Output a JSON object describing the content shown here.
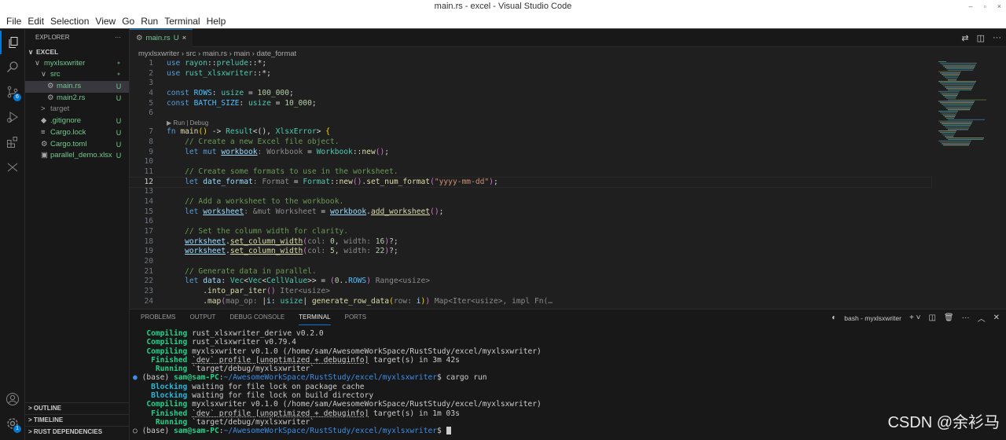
{
  "window": {
    "title": "main.rs - excel - Visual Studio Code",
    "controls": [
      "–",
      "▫",
      "×"
    ]
  },
  "menu": [
    "File",
    "Edit",
    "Selection",
    "View",
    "Go",
    "Run",
    "Terminal",
    "Help"
  ],
  "activity": {
    "scm_badge": "6",
    "settings_badge": "1"
  },
  "sidebar": {
    "title": "EXPLORER",
    "more": "···",
    "root": "EXCEL",
    "items": [
      {
        "label": "myxlsxwriter",
        "indent": 1,
        "twisty": "∨",
        "status": "●",
        "color": "green"
      },
      {
        "label": "src",
        "indent": 2,
        "twisty": "∨",
        "status": "●",
        "color": "green"
      },
      {
        "label": "main.rs",
        "indent": 3,
        "icon": "⚙",
        "status": "U",
        "color": "green",
        "selected": true
      },
      {
        "label": "main2.rs",
        "indent": 3,
        "icon": "⚙",
        "status": "U",
        "color": "green"
      },
      {
        "label": "target",
        "indent": 2,
        "twisty": ">",
        "status": "",
        "color": "grey"
      },
      {
        "label": ".gitignore",
        "indent": 2,
        "icon": "◆",
        "status": "U",
        "color": "green"
      },
      {
        "label": "Cargo.lock",
        "indent": 2,
        "icon": "≡",
        "status": "U",
        "color": "green"
      },
      {
        "label": "Cargo.toml",
        "indent": 2,
        "icon": "⚙",
        "status": "U",
        "color": "green"
      },
      {
        "label": "parallel_demo.xlsx",
        "indent": 2,
        "icon": "▣",
        "status": "U",
        "color": "green"
      }
    ],
    "sections": [
      "OUTLINE",
      "TIMELINE",
      "RUST DEPENDENCIES"
    ]
  },
  "editor": {
    "tab": {
      "label": "main.rs",
      "status": "U",
      "close": "×"
    },
    "breadcrumb": [
      "myxlsxwriter",
      "src",
      "main.rs",
      "main",
      "date_format"
    ],
    "codelens": "▶ Run | Debug",
    "current_line": 12,
    "lines": [
      [
        [
          "use ",
          "kw"
        ],
        [
          "rayon",
          "ty"
        ],
        [
          "::",
          "pu"
        ],
        [
          "prelude",
          "ty"
        ],
        [
          "::*;",
          "pu"
        ]
      ],
      [
        [
          "use ",
          "kw"
        ],
        [
          "rust_xlsxwriter",
          "ty"
        ],
        [
          "::*;",
          "pu"
        ]
      ],
      [],
      [
        [
          "const ",
          "kw"
        ],
        [
          "ROWS",
          "co"
        ],
        [
          ": ",
          "pu"
        ],
        [
          "usize",
          "ty"
        ],
        [
          " = ",
          "pu"
        ],
        [
          "100_000",
          "nu"
        ],
        [
          ";",
          "pu"
        ]
      ],
      [
        [
          "const ",
          "kw"
        ],
        [
          "BATCH_SIZE",
          "co"
        ],
        [
          ": ",
          "pu"
        ],
        [
          "usize",
          "ty"
        ],
        [
          " = ",
          "pu"
        ],
        [
          "10_000",
          "nu"
        ],
        [
          ";",
          "pu"
        ]
      ],
      [],
      [
        [
          "fn ",
          "kw"
        ],
        [
          "main",
          "fn"
        ],
        [
          "()",
          "br"
        ],
        [
          " -> ",
          "pu"
        ],
        [
          "Result",
          "ty"
        ],
        [
          "<(), ",
          "pu"
        ],
        [
          "XlsxError",
          "ty"
        ],
        [
          "> ",
          "pu"
        ],
        [
          "{",
          "br"
        ]
      ],
      [
        [
          "    // Create a new Excel file object.",
          "cm"
        ]
      ],
      [
        [
          "    let mut ",
          "kw"
        ],
        [
          "workbook",
          "va ul"
        ],
        [
          ": Workbook",
          "hi"
        ],
        [
          " = ",
          "pu"
        ],
        [
          "Workbook",
          "ty"
        ],
        [
          "::",
          "pu"
        ],
        [
          "new",
          "fn"
        ],
        [
          "()",
          "br2"
        ],
        [
          ";",
          "pu"
        ]
      ],
      [],
      [
        [
          "    // Create some formats to use in the worksheet.",
          "cm"
        ]
      ],
      [
        [
          "    let ",
          "kw"
        ],
        [
          "date_format",
          "va"
        ],
        [
          ": Format",
          "hi"
        ],
        [
          " = ",
          "pu"
        ],
        [
          "Format",
          "ty"
        ],
        [
          "::",
          "pu"
        ],
        [
          "new",
          "fn"
        ],
        [
          "()",
          "br2"
        ],
        [
          ".",
          "pu"
        ],
        [
          "set_num_format",
          "fn"
        ],
        [
          "(",
          "br2"
        ],
        [
          "\"yyyy-mm-dd\"",
          "st"
        ],
        [
          ")",
          "br2"
        ],
        [
          ";",
          "pu"
        ]
      ],
      [],
      [
        [
          "    // Add a worksheet to the workbook.",
          "cm"
        ]
      ],
      [
        [
          "    let ",
          "kw"
        ],
        [
          "worksheet",
          "va ul"
        ],
        [
          ": &mut Worksheet",
          "hi"
        ],
        [
          " = ",
          "pu"
        ],
        [
          "workbook",
          "va ul"
        ],
        [
          ".",
          "pu"
        ],
        [
          "add_worksheet",
          "fn ul"
        ],
        [
          "()",
          "br2"
        ],
        [
          ";",
          "pu"
        ]
      ],
      [],
      [
        [
          "    // Set the column width for clarity.",
          "cm"
        ]
      ],
      [
        [
          "    ",
          "pu"
        ],
        [
          "worksheet",
          "va ul"
        ],
        [
          ".",
          "pu"
        ],
        [
          "set_column_width",
          "fn ul"
        ],
        [
          "(",
          "br2"
        ],
        [
          "col: ",
          "hi"
        ],
        [
          "0",
          "nu"
        ],
        [
          ", ",
          "pu"
        ],
        [
          "width: ",
          "hi"
        ],
        [
          "16",
          "nu"
        ],
        [
          ")",
          "br2"
        ],
        [
          "?;",
          "pu"
        ]
      ],
      [
        [
          "    ",
          "pu"
        ],
        [
          "worksheet",
          "va ul"
        ],
        [
          ".",
          "pu"
        ],
        [
          "set_column_width",
          "fn ul"
        ],
        [
          "(",
          "br2"
        ],
        [
          "col: ",
          "hi"
        ],
        [
          "5",
          "nu"
        ],
        [
          ", ",
          "pu"
        ],
        [
          "width: ",
          "hi"
        ],
        [
          "22",
          "nu"
        ],
        [
          ")",
          "br2"
        ],
        [
          "?;",
          "pu"
        ]
      ],
      [],
      [
        [
          "    // Generate data in parallel.",
          "cm"
        ]
      ],
      [
        [
          "    let ",
          "kw"
        ],
        [
          "data",
          "va"
        ],
        [
          ": ",
          "pu"
        ],
        [
          "Vec",
          "ty"
        ],
        [
          "<",
          "pu"
        ],
        [
          "Vec",
          "ty"
        ],
        [
          "<",
          "pu"
        ],
        [
          "CellValue",
          "ty"
        ],
        [
          ">> = ",
          "pu"
        ],
        [
          "(",
          "br2"
        ],
        [
          "0",
          "nu"
        ],
        [
          "..",
          "pu"
        ],
        [
          "ROWS",
          "co"
        ],
        [
          ")",
          "br2"
        ],
        [
          " Range<usize>",
          "hi"
        ]
      ],
      [
        [
          "        .",
          "pu"
        ],
        [
          "into_par_iter",
          "fn"
        ],
        [
          "()",
          "br2"
        ],
        [
          " Iter<usize>",
          "hi"
        ]
      ],
      [
        [
          "        .",
          "pu"
        ],
        [
          "map",
          "fn"
        ],
        [
          "(",
          "br2"
        ],
        [
          "map_op: ",
          "hi"
        ],
        [
          "|",
          "pu"
        ],
        [
          "i",
          "va"
        ],
        [
          ": ",
          "pu"
        ],
        [
          "usize",
          "ty"
        ],
        [
          "| ",
          "pu"
        ],
        [
          "generate_row_data",
          "fn"
        ],
        [
          "(",
          "br"
        ],
        [
          "row: ",
          "hi"
        ],
        [
          "i",
          "va"
        ],
        [
          ")",
          "br"
        ],
        [
          ")",
          "br2"
        ],
        [
          " Map<Iter<usize>, impl Fn(…",
          "hi"
        ]
      ]
    ]
  },
  "panel": {
    "tabs": [
      "PROBLEMS",
      "OUTPUT",
      "DEBUG CONSOLE",
      "TERMINAL",
      "PORTS"
    ],
    "active": "TERMINAL",
    "terminal_name": "bash - myxlsxwriter",
    "terminal_lines": [
      [
        [
          "   Compiling",
          "tg"
        ],
        [
          " rust_xlsxwriter_derive v0.2.0",
          ""
        ]
      ],
      [
        [
          "   Compiling",
          "tg"
        ],
        [
          " rust_xlsxwriter v0.79.4",
          ""
        ]
      ],
      [
        [
          "   Compiling",
          "tg"
        ],
        [
          " myxlsxwriter v0.1.0 (/home/sam/AwesomeWorkSpace/RustStudy/excel/myxlsxwriter)",
          ""
        ]
      ],
      [
        [
          "    Finished",
          "tg"
        ],
        [
          " ",
          ""
        ],
        [
          "`dev` profile [unoptimized + debuginfo]",
          "tu"
        ],
        [
          " target(s) in 3m 42s",
          ""
        ]
      ],
      [
        [
          "     Running",
          "tg"
        ],
        [
          " `target/debug/myxlsxwriter`",
          ""
        ]
      ],
      [
        [
          "● ",
          "tb"
        ],
        [
          "(base) ",
          ""
        ],
        [
          "sam@sam-PC",
          "tg"
        ],
        [
          ":",
          ""
        ],
        [
          "~/AwesomeWorkSpace/RustStudy/excel/myxlsxwriter",
          "tb"
        ],
        [
          "$ cargo run",
          ""
        ]
      ],
      [
        [
          "    Blocking",
          "tc"
        ],
        [
          " waiting for file lock on package cache",
          ""
        ]
      ],
      [
        [
          "    Blocking",
          "tc"
        ],
        [
          " waiting for file lock on build directory",
          ""
        ]
      ],
      [
        [
          "   Compiling",
          "tg"
        ],
        [
          " myxlsxwriter v0.1.0 (/home/sam/AwesomeWorkSpace/RustStudy/excel/myxlsxwriter)",
          ""
        ]
      ],
      [
        [
          "    Finished",
          "tg"
        ],
        [
          " ",
          ""
        ],
        [
          "`dev` profile [unoptimized + debuginfo]",
          "tu"
        ],
        [
          " target(s) in 1m 03s",
          ""
        ]
      ],
      [
        [
          "     Running",
          "tg"
        ],
        [
          " `target/debug/myxlsxwriter`",
          ""
        ]
      ],
      [
        [
          "○ ",
          ""
        ],
        [
          "(base) ",
          ""
        ],
        [
          "sam@sam-PC",
          "tg"
        ],
        [
          ":",
          ""
        ],
        [
          "~/AwesomeWorkSpace/RustStudy/excel/myxlsxwriter",
          "tb"
        ],
        [
          "$ ",
          ""
        ]
      ]
    ]
  },
  "watermark": "CSDN @余衫马",
  "colors": {
    "accent": "#0078d4",
    "editor_bg": "#1f1f1f",
    "sidebar_bg": "#181818",
    "git_untracked": "#73c991"
  }
}
